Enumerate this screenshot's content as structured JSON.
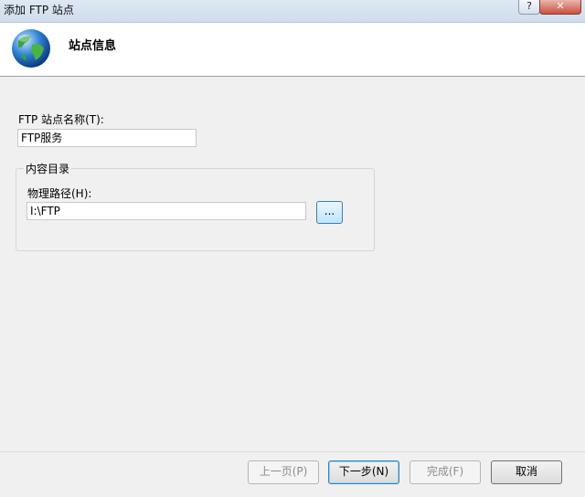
{
  "window": {
    "title": "添加 FTP 站点",
    "help_label": "?",
    "close_label": "✕"
  },
  "header": {
    "title": "站点信息",
    "icon": "globe-icon"
  },
  "form": {
    "site_name_label": "FTP 站点名称(T):",
    "site_name_value": "FTP服务",
    "content_group_label": "内容目录",
    "physical_path_label": "物理路径(H):",
    "physical_path_value": "I:\\FTP",
    "browse_label": "..."
  },
  "buttons": {
    "previous": "上一页(P)",
    "next": "下一步(N)",
    "finish": "完成(F)",
    "cancel": "取消"
  }
}
